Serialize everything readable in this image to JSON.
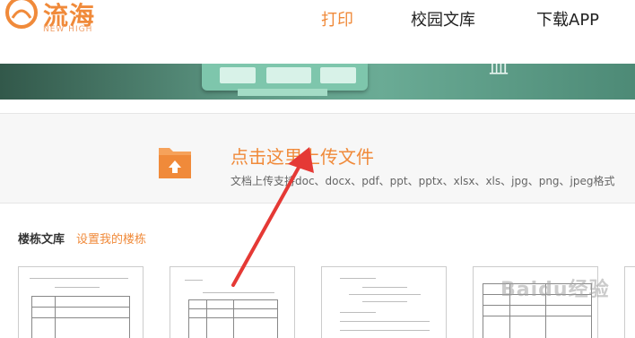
{
  "header": {
    "logo_text": "流海",
    "logo_subtext": "NEW HIGH",
    "nav": {
      "print": "打印",
      "library": "校园文库",
      "download_app": "下载APP"
    }
  },
  "banner": {
    "text": "血"
  },
  "upload": {
    "title": "点击这里上传文件",
    "formats": "文档上传支持doc、docx、pdf、ppt、pptx、xlsx、xls、jpg、png、jpeg格式"
  },
  "library": {
    "title": "楼栋文库",
    "set_link": "设置我的楼栋"
  },
  "watermark": "Baidu经验",
  "colors": {
    "accent": "#f08a3a",
    "arrow": "#e53935"
  },
  "icons": {
    "upload_folder": "folder-upload-icon"
  }
}
